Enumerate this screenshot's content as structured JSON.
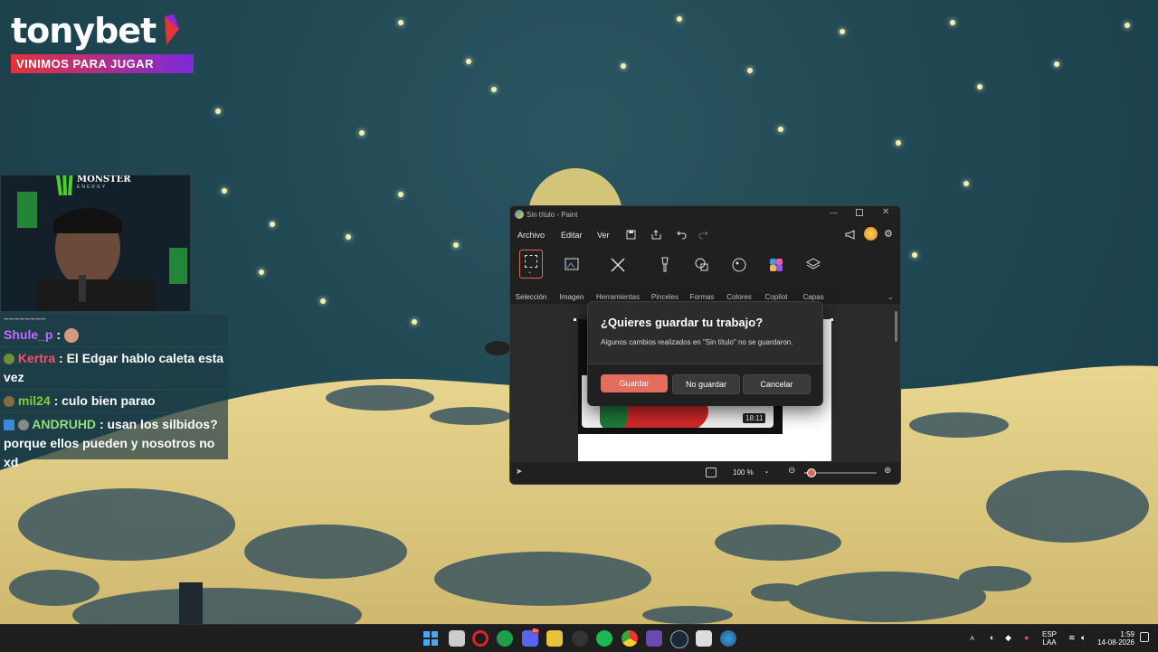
{
  "brand": {
    "name": "tonybet",
    "tagline": "VINIMOS PARA JUGAR",
    "accent": "#e5333a"
  },
  "webcam": {
    "sponsor": "MONSTER",
    "sponsor_sub": "ENERGY"
  },
  "chat": {
    "top_partial": "~~~~~~~~",
    "lines": [
      {
        "user": "Shule_p",
        "user_color": "#c06bff",
        "message": ""
      },
      {
        "user": "Kertra",
        "user_color": "#ff4d6a",
        "message": ": El Edgar hablo caleta esta vez"
      },
      {
        "user": "mil24",
        "user_color": "#7cd13a",
        "message": ": culo bien parao"
      },
      {
        "user": "ANDRUHD",
        "user_color": "#8ee07a",
        "message": ": usan los silbidos? porque ellos pueden y nosotros no xd"
      }
    ]
  },
  "paint": {
    "title": "Sin título - Paint",
    "menu": {
      "file": "Archivo",
      "edit": "Editar",
      "view": "Ver"
    },
    "ribbon": [
      {
        "label": "Selección",
        "icon": "selection-icon"
      },
      {
        "label": "Imagen",
        "icon": "image-icon"
      },
      {
        "label": "Herramientas",
        "icon": "tools-icon"
      },
      {
        "label": "Pinceles",
        "icon": "brush-icon"
      },
      {
        "label": "Formas",
        "icon": "shapes-icon"
      },
      {
        "label": "Colores",
        "icon": "palette-icon"
      },
      {
        "label": "Copilot",
        "icon": "copilot-icon"
      },
      {
        "label": "Capas",
        "icon": "layers-icon"
      }
    ],
    "canvas_timestamp": "18:11",
    "zoom": "100 %",
    "zoom_level_fraction": 0.1
  },
  "dialog": {
    "title": "¿Quieres guardar tu trabajo?",
    "message": "Algunos cambios realizados en \"Sin título\" no se guardaron.",
    "save": "Guardar",
    "dont_save": "No guardar",
    "cancel": "Cancelar",
    "save_color": "#e36e5e"
  },
  "taskbar": {
    "lang": "ESP",
    "lang_sub": "LAA",
    "time": "1:59",
    "date": "14-08-2026",
    "badge_count": "9+"
  }
}
